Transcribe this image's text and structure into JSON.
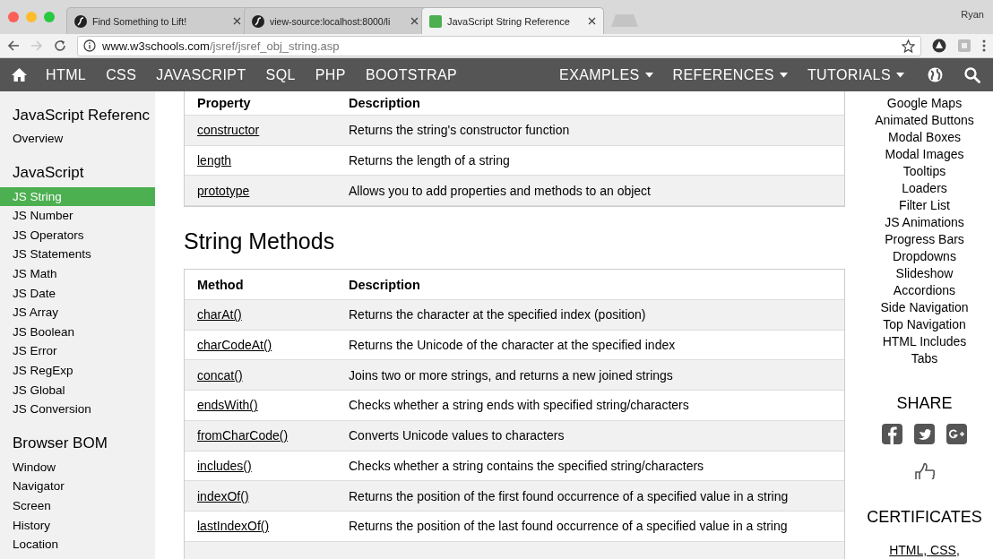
{
  "browser": {
    "tabs": [
      {
        "title": "Find Something to Lift!",
        "selected": false,
        "kind": "site"
      },
      {
        "title": "view-source:localhost:8000/li",
        "selected": false,
        "kind": "site"
      },
      {
        "title": "JavaScript String Reference",
        "selected": true,
        "kind": "reference"
      }
    ],
    "profile": "Ryan",
    "forward_disabled": true,
    "url_host": "www.w3schools.com",
    "url_path": "/jsref/jsref_obj_string.asp"
  },
  "navbar": {
    "items": [
      {
        "label": "HTML",
        "dropdown": false
      },
      {
        "label": "CSS",
        "dropdown": false
      },
      {
        "label": "JAVASCRIPT",
        "dropdown": false
      },
      {
        "label": "SQL",
        "dropdown": false
      },
      {
        "label": "PHP",
        "dropdown": false
      },
      {
        "label": "BOOTSTRAP",
        "dropdown": false
      }
    ],
    "right_items": [
      {
        "label": "EXAMPLES",
        "dropdown": true
      },
      {
        "label": "REFERENCES",
        "dropdown": true
      },
      {
        "label": "TUTORIALS",
        "dropdown": true
      }
    ]
  },
  "sidebar": {
    "sections": [
      {
        "heading": "JavaScript Referenc",
        "items": [
          {
            "label": "Overview",
            "selected": false
          }
        ]
      },
      {
        "heading": "JavaScript",
        "items": [
          {
            "label": "JS String",
            "selected": true
          },
          {
            "label": "JS Number",
            "selected": false
          },
          {
            "label": "JS Operators",
            "selected": false
          },
          {
            "label": "JS Statements",
            "selected": false
          },
          {
            "label": "JS Math",
            "selected": false
          },
          {
            "label": "JS Date",
            "selected": false
          },
          {
            "label": "JS Array",
            "selected": false
          },
          {
            "label": "JS Boolean",
            "selected": false
          },
          {
            "label": "JS Error",
            "selected": false
          },
          {
            "label": "JS RegExp",
            "selected": false
          },
          {
            "label": "JS Global",
            "selected": false
          },
          {
            "label": "JS Conversion",
            "selected": false
          }
        ]
      },
      {
        "heading": "Browser BOM",
        "items": [
          {
            "label": "Window",
            "selected": false
          },
          {
            "label": "Navigator",
            "selected": false
          },
          {
            "label": "Screen",
            "selected": false
          },
          {
            "label": "History",
            "selected": false
          },
          {
            "label": "Location",
            "selected": false
          }
        ]
      }
    ]
  },
  "property_table": {
    "columns": [
      "Property",
      "Description"
    ],
    "rows": [
      {
        "name": "constructor",
        "description": "Returns the string's constructor function"
      },
      {
        "name": "length",
        "description": "Returns the length of a string"
      },
      {
        "name": "prototype",
        "description": "Allows you to add properties and methods to an object"
      }
    ]
  },
  "methods_heading": "String Methods",
  "methods_table": {
    "columns": [
      "Method",
      "Description"
    ],
    "rows": [
      {
        "name": "charAt()",
        "description": "Returns the character at the specified index (position)"
      },
      {
        "name": "charCodeAt()",
        "description": "Returns the Unicode of the character at the specified index"
      },
      {
        "name": "concat()",
        "description": "Joins two or more strings, and returns a new joined strings"
      },
      {
        "name": "endsWith()",
        "description": "Checks whether a string ends with specified string/characters"
      },
      {
        "name": "fromCharCode()",
        "description": "Converts Unicode values to characters"
      },
      {
        "name": "includes()",
        "description": "Checks whether a string contains the specified string/characters"
      },
      {
        "name": "indexOf()",
        "description": "Returns the position of the first found occurrence of a specified value in a string"
      },
      {
        "name": "lastIndexOf()",
        "description": "Returns the position of the last found occurrence of a specified value in a string"
      }
    ]
  },
  "right_column": {
    "links": [
      "Google Maps",
      "Animated Buttons",
      "Modal Boxes",
      "Modal Images",
      "Tooltips",
      "Loaders",
      "Filter List",
      "JS Animations",
      "Progress Bars",
      "Dropdowns",
      "Slideshow",
      "Accordions",
      "Side Navigation",
      "Top Navigation",
      "HTML Includes",
      "Tabs"
    ],
    "share_heading": "SHARE",
    "certificates_heading": "CERTIFICATES",
    "certificates_text": "HTML, CSS,"
  }
}
